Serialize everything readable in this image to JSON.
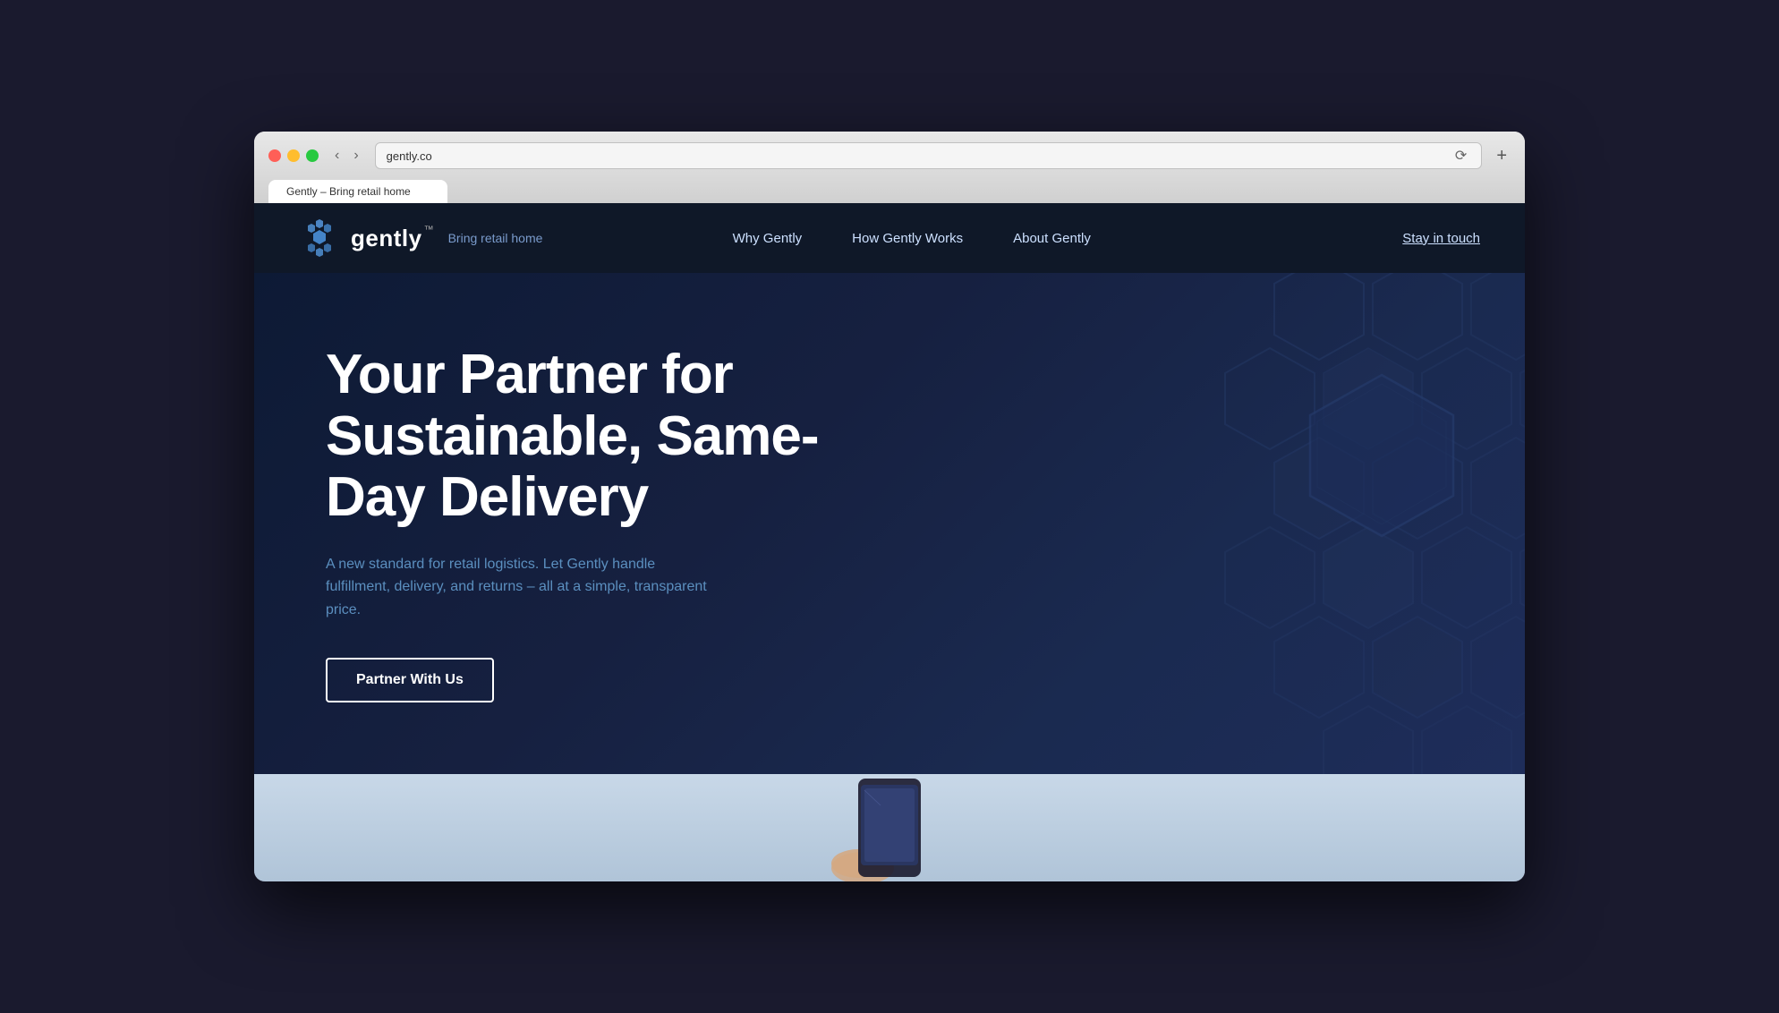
{
  "browser": {
    "address": "gently.co",
    "tab_label": "Gently – Bring retail home"
  },
  "nav": {
    "logo_text": "gently",
    "logo_tm": "™",
    "tagline": "Bring retail home",
    "links": [
      {
        "id": "why-gently",
        "label": "Why Gently"
      },
      {
        "id": "how-gently-works",
        "label": "How Gently Works"
      },
      {
        "id": "about-gently",
        "label": "About Gently"
      }
    ],
    "cta_label": "Stay in touch"
  },
  "hero": {
    "title": "Your Partner for Sustainable, Same-Day Delivery",
    "subtitle": "A new standard for retail logistics. Let Gently handle fulfillment, delivery, and returns – all at a simple, transparent price.",
    "cta_label": "Partner With Us"
  }
}
